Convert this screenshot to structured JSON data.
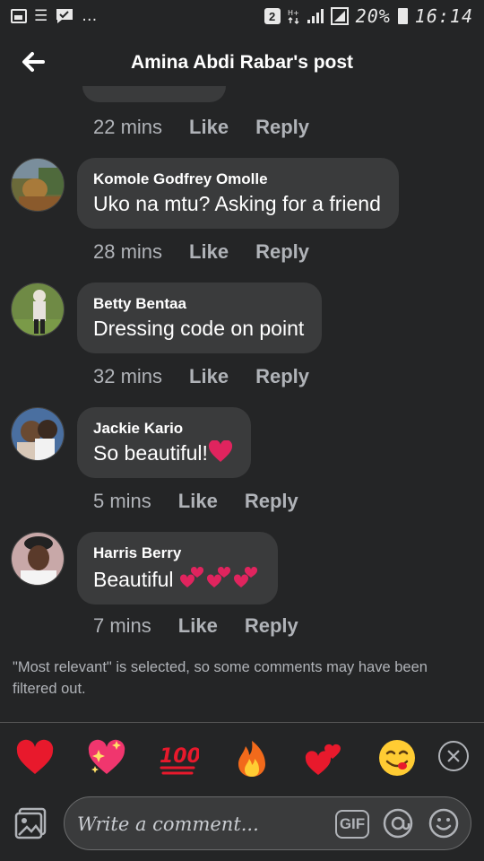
{
  "status_bar": {
    "notification_count": "2",
    "battery_percent": "20%",
    "time": "16:14",
    "icons": [
      "image-icon",
      "list-icon",
      "chat-check-icon",
      "more-dots-icon",
      "sim-badge-icon",
      "data-arrows-icon",
      "signal-icon",
      "signal-boxed-icon",
      "battery-icon"
    ]
  },
  "header": {
    "title": "Amina Abdi Rabar's post",
    "back_icon": "arrow-left-icon"
  },
  "previous_comment_meta": {
    "time": "22 mins",
    "like_label": "Like",
    "reply_label": "Reply"
  },
  "comments": [
    {
      "author": "Komole Godfrey Omolle",
      "text": "Uko na mtu? Asking for a friend",
      "time": "28 mins",
      "like_label": "Like",
      "reply_label": "Reply"
    },
    {
      "author": "Betty Bentaa",
      "text": "Dressing code on point",
      "time": "32 mins",
      "like_label": "Like",
      "reply_label": "Reply"
    },
    {
      "author": "Jackie Kario",
      "text": "So beautiful!",
      "emoji": "red-heart",
      "time": "5 mins",
      "like_label": "Like",
      "reply_label": "Reply"
    },
    {
      "author": "Harris Berry",
      "text": "Beautiful ",
      "emoji": "two-hearts x3",
      "time": "7 mins",
      "like_label": "Like",
      "reply_label": "Reply"
    }
  ],
  "filter_notice": "\"Most relevant\" is selected, so some comments may have been filtered out.",
  "quick_emojis": [
    "red-heart",
    "sparkling-heart",
    "hundred-points",
    "fire",
    "two-hearts",
    "face-savoring-food"
  ],
  "composer": {
    "placeholder": "Write a comment...",
    "gif_label": "GIF",
    "icons": [
      "photo-icon",
      "gif-icon",
      "at-icon",
      "smile-icon"
    ]
  },
  "colors": {
    "background": "#242526",
    "bubble": "#3a3b3c",
    "secondary_text": "#b0b3b8",
    "heart_red": "#e0245e"
  }
}
